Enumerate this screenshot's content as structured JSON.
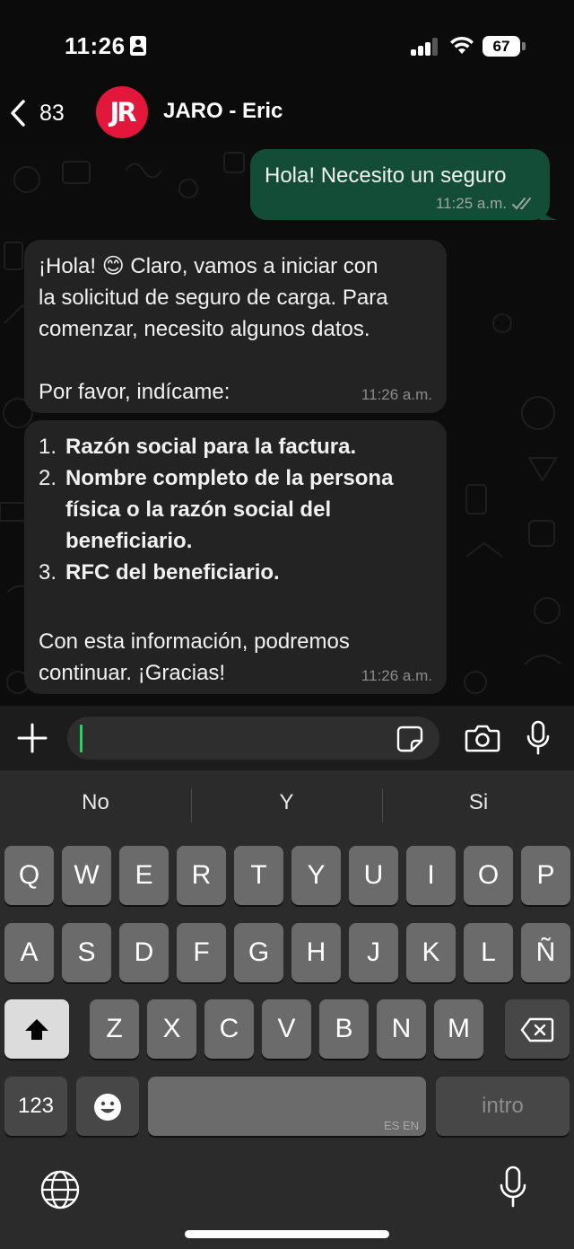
{
  "status_bar": {
    "time": "11:26",
    "battery": "67"
  },
  "header": {
    "back_count": "83",
    "avatar_initials": "JR",
    "contact_name": "JARO - Eric",
    "avatar_color": "#e3163b"
  },
  "messages": [
    {
      "direction": "outgoing",
      "text": "Hola! Necesito un seguro",
      "time": "11:25 a.m.",
      "status": "read"
    },
    {
      "direction": "incoming",
      "text": "¡Hola! 😊 Claro, vamos a iniciar con\nla solicitud de seguro de carga. Para\ncomenzar, necesito algunos datos.\n\nPor favor, indícame:",
      "time": "11:26 a.m."
    },
    {
      "direction": "incoming",
      "list": [
        {
          "num": "1.",
          "text": "Razón social para la factura."
        },
        {
          "num": "2.",
          "text": "Nombre completo de la persona física o la razón social del beneficiario."
        },
        {
          "num": "3.",
          "text": "RFC del beneficiario."
        }
      ],
      "footer": "Con esta información, podremos\ncontinuar. ¡Gracias!",
      "time": "11:26 a.m."
    }
  ],
  "input": {
    "value": "",
    "placeholder": ""
  },
  "keyboard": {
    "suggestions": [
      "No",
      "Y",
      "Si"
    ],
    "row1": [
      "Q",
      "W",
      "E",
      "R",
      "T",
      "Y",
      "U",
      "I",
      "O",
      "P"
    ],
    "row2": [
      "A",
      "S",
      "D",
      "F",
      "G",
      "H",
      "J",
      "K",
      "L",
      "Ñ"
    ],
    "row3": [
      "Z",
      "X",
      "C",
      "V",
      "B",
      "N",
      "M"
    ],
    "numbers_key": "123",
    "space_lang": "ES EN",
    "return_key": "intro"
  },
  "colors": {
    "outgoing_bubble": "#134d37",
    "incoming_bubble": "#232323",
    "cursor": "#25d366"
  }
}
